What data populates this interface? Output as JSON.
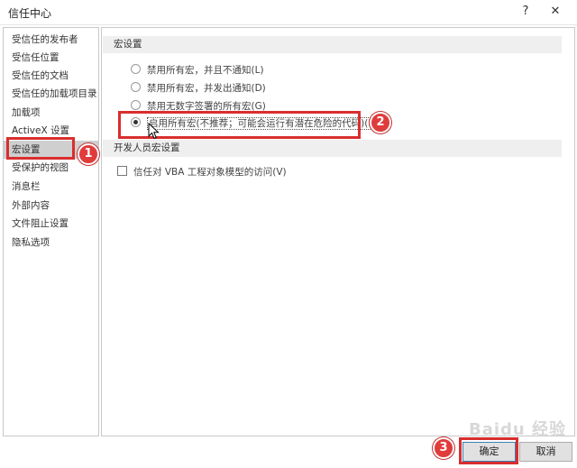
{
  "window": {
    "title": "信任中心",
    "help_icon": "?",
    "close_icon": "✕"
  },
  "sidebar": {
    "items": [
      {
        "label": "受信任的发布者",
        "selected": false
      },
      {
        "label": "受信任位置",
        "selected": false
      },
      {
        "label": "受信任的文档",
        "selected": false
      },
      {
        "label": "受信任的加载项目录",
        "selected": false
      },
      {
        "label": "加载项",
        "selected": false
      },
      {
        "label": "ActiveX 设置",
        "selected": false
      },
      {
        "label": "宏设置",
        "selected": true
      },
      {
        "label": "受保护的视图",
        "selected": false
      },
      {
        "label": "消息栏",
        "selected": false
      },
      {
        "label": "外部内容",
        "selected": false
      },
      {
        "label": "文件阻止设置",
        "selected": false
      },
      {
        "label": "隐私选项",
        "selected": false
      }
    ]
  },
  "macro_settings": {
    "heading": "宏设置",
    "options": [
      {
        "label": "禁用所有宏，并且不通知(L)",
        "checked": false
      },
      {
        "label": "禁用所有宏，并发出通知(D)",
        "checked": false
      },
      {
        "label": "禁用无数字签署的所有宏(G)",
        "checked": false
      },
      {
        "label": "启用所有宏(不推荐；可能会运行有潜在危险的代码)(E)",
        "checked": true
      }
    ]
  },
  "developer_settings": {
    "heading": "开发人员宏设置",
    "checkbox_label": "信任对 VBA 工程对象模型的访问(V)",
    "checked": false
  },
  "buttons": {
    "ok": "确定",
    "cancel": "取消"
  },
  "annotations": {
    "step1": "1",
    "step2": "2",
    "step3": "3"
  },
  "watermark": "Baidu 经验",
  "colors": {
    "highlight": "#d92e2e",
    "selected_bg": "#cfcfcf",
    "section_bg": "#efefef"
  }
}
